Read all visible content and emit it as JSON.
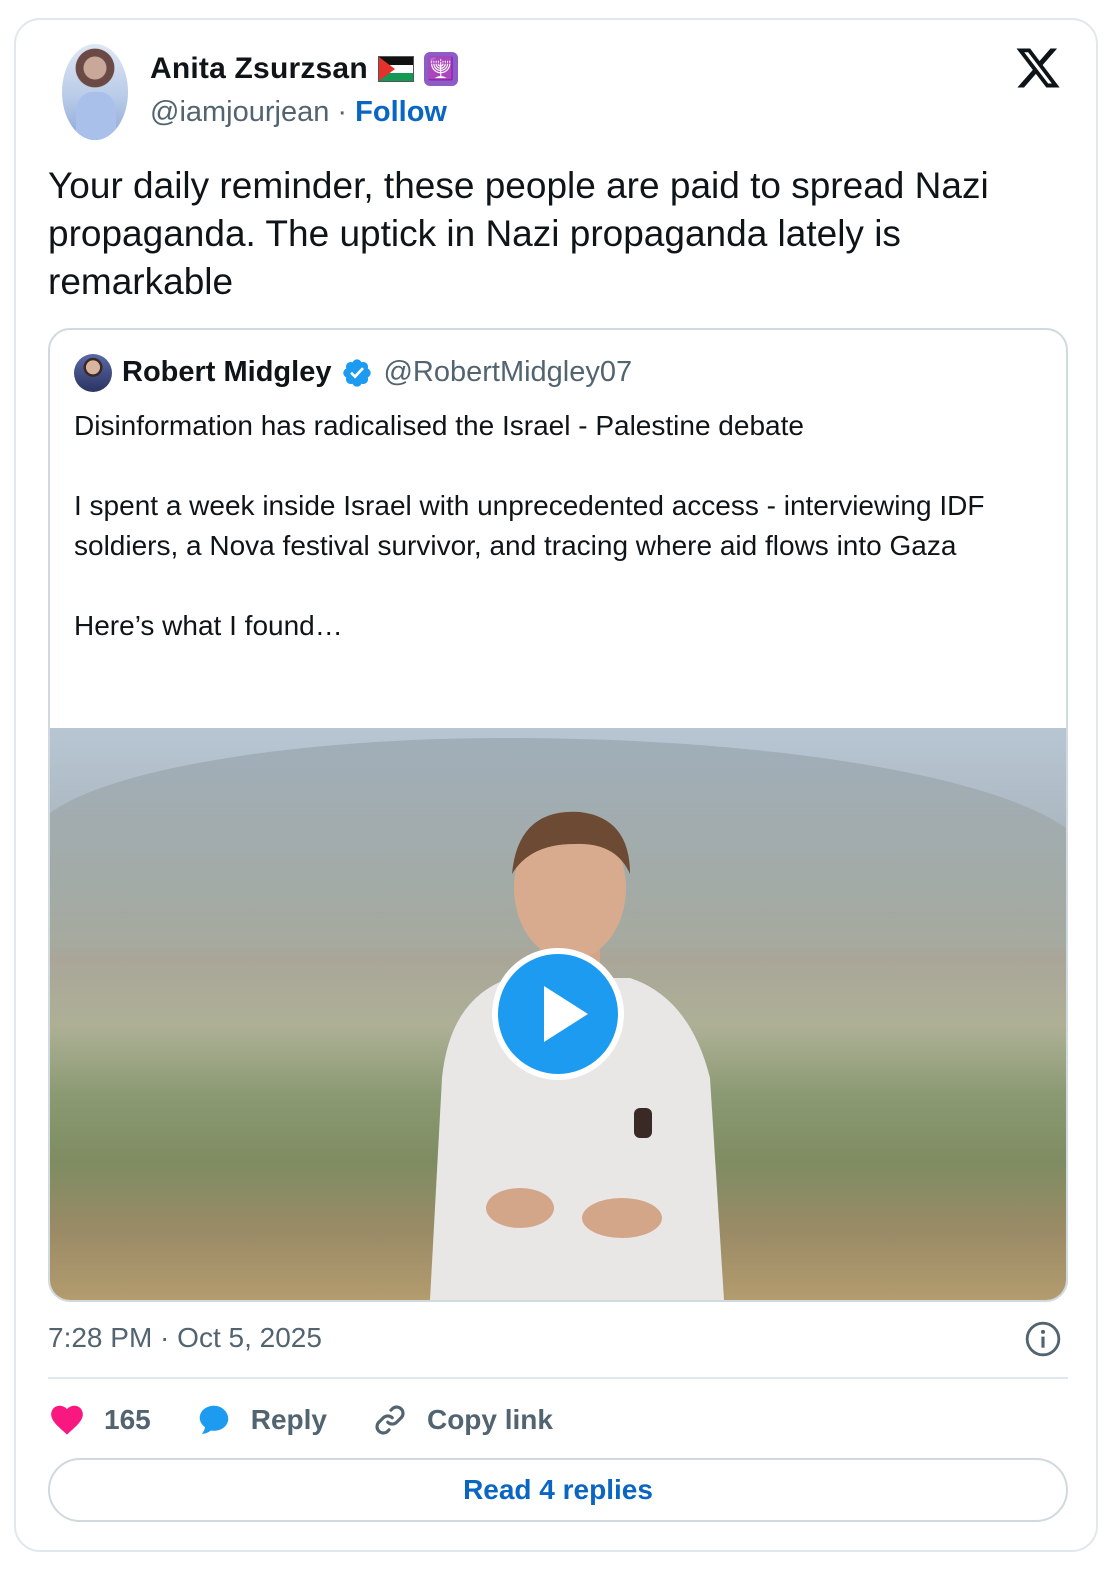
{
  "author": {
    "name": "Anita Zsurzsan",
    "handle": "@iamjourjean",
    "separator": "·",
    "follow_label": "Follow",
    "badges": [
      "palestine-flag-emoji",
      "menorah-emoji"
    ]
  },
  "tweet": {
    "text": "Your daily reminder, these people are paid to spread Nazi propaganda. The uptick in Nazi propaganda lately is remarkable",
    "timestamp": "7:28 PM · Oct 5, 2025"
  },
  "quoted": {
    "name": "Robert Midgley",
    "handle": "@RobertMidgley07",
    "verified": true,
    "text": "Disinformation has radicalised the Israel - Palestine debate\n\nI spent a week inside Israel with unprecedented access - interviewing IDF soldiers, a Nova festival survivor, and tracing where aid flows into Gaza\n\nHere’s what I found…"
  },
  "actions": {
    "likes": "165",
    "reply_label": "Reply",
    "copy_label": "Copy link"
  },
  "read_replies_label": "Read 4 replies",
  "colors": {
    "accent": "#0a66c2",
    "like": "#f91880",
    "play": "#1d9bf0",
    "muted": "#536471"
  }
}
